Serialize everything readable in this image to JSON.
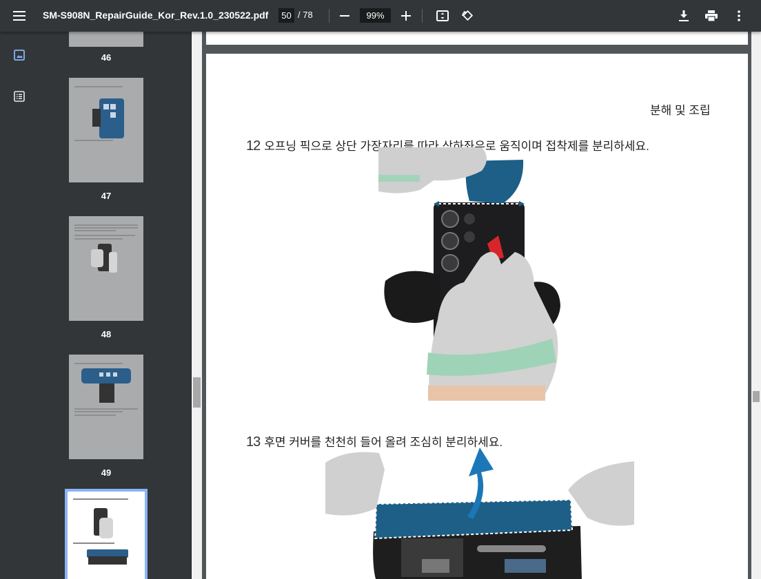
{
  "toolbar": {
    "title": "SM-S908N_RepairGuide_Kor_Rev.1.0_230522.pdf",
    "current_page": "50",
    "total_pages": "/ 78",
    "zoom": "99%",
    "icons": [
      "menu-icon",
      "zoom-out-icon",
      "zoom-in-icon",
      "fit-page-icon",
      "rotate-icon",
      "download-icon",
      "print-icon",
      "more-vert-icon"
    ]
  },
  "sidebar": {
    "thumbnails": [
      {
        "page": "46"
      },
      {
        "page": "47"
      },
      {
        "page": "48"
      },
      {
        "page": "49"
      },
      {
        "page": "50",
        "selected": true
      }
    ]
  },
  "document": {
    "section_title": "분해 및 조립",
    "steps": [
      {
        "number": "12",
        "text": "오프닝 픽으로 상단 가장자리를 따라 상하좌우로 움직이며 접착제를 분리하세요."
      },
      {
        "number": "13",
        "text": "후면 커버를 천천히 들어 올려 조심히 분리하세요."
      }
    ]
  },
  "colors": {
    "toolbar_bg": "#323639",
    "viewer_bg": "#525659",
    "selection": "#8ab4f8",
    "pick_blue": "#1d5f86"
  }
}
